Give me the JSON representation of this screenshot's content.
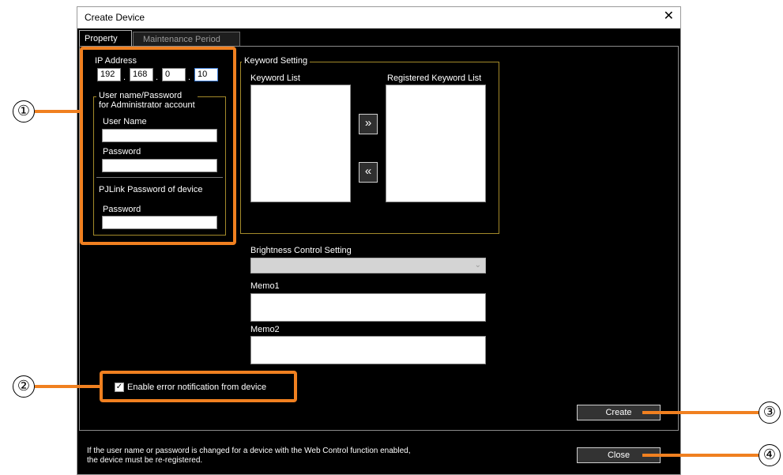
{
  "window": {
    "title": "Create Device",
    "close_glyph": "✕"
  },
  "tabs": [
    {
      "label": "Property",
      "selected": true
    },
    {
      "label": "Maintenance Period",
      "selected": false
    }
  ],
  "ip_address": {
    "label": "IP Address",
    "octets": [
      "192",
      "168",
      "0",
      "10"
    ],
    "separator": "."
  },
  "admin_account": {
    "group_title_line1": "User name/Password",
    "group_title_line2": "for Administrator account",
    "user_name_label": "User Name",
    "user_name_value": "",
    "password_label": "Password",
    "password_value": ""
  },
  "pjlink": {
    "label": "PJLink Password of device",
    "password_label": "Password",
    "password_value": ""
  },
  "keyword_setting": {
    "group_title": "Keyword Setting",
    "keyword_list_label": "Keyword List",
    "registered_list_label": "Registered Keyword List",
    "add_glyph": "»",
    "remove_glyph": "«"
  },
  "brightness": {
    "label": "Brightness Control Setting",
    "selected": ""
  },
  "memo1": {
    "label": "Memo1",
    "value": ""
  },
  "memo2": {
    "label": "Memo2",
    "value": ""
  },
  "error_notification": {
    "label": "Enable error notification from device",
    "checked": true
  },
  "buttons": {
    "create": "Create",
    "close": "Close"
  },
  "footer_note": {
    "line1": "If the user name or password is changed for a device with the Web Control function enabled,",
    "line2": "the device must be re-registered."
  },
  "callouts": [
    "①",
    "②",
    "③",
    "④"
  ],
  "colors": {
    "highlight": "#f08020",
    "dialog_bg": "#000000",
    "group_border": "#a38a2a"
  }
}
